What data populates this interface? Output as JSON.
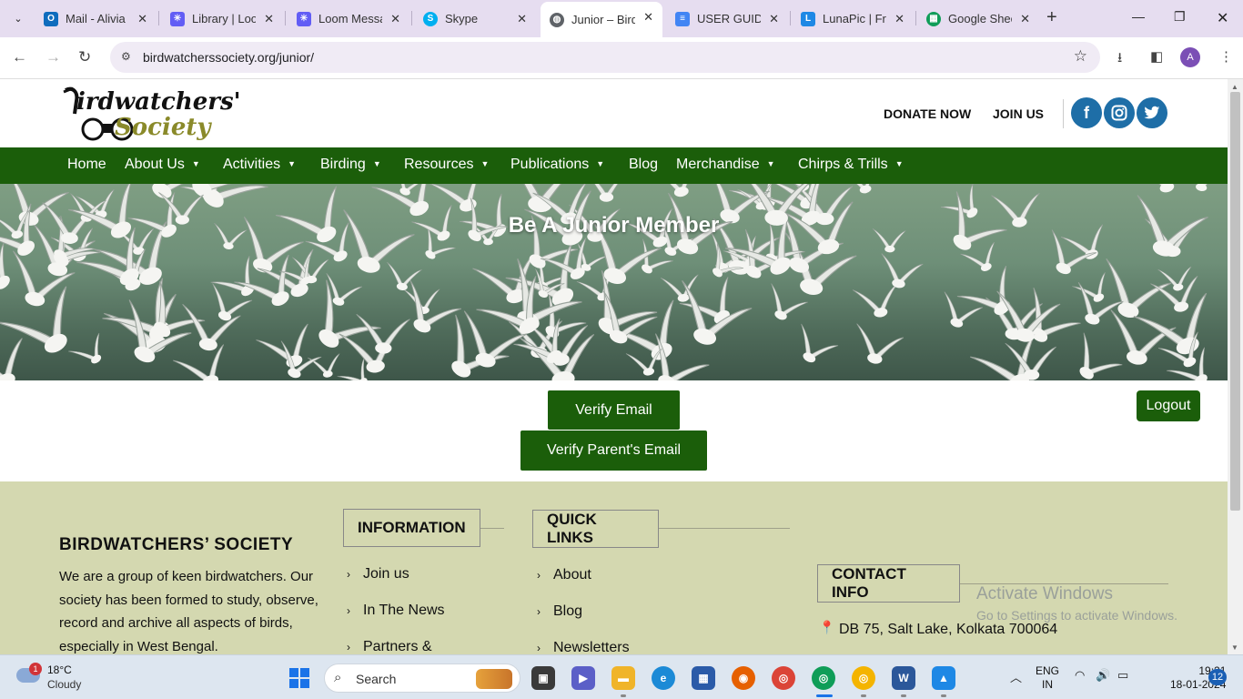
{
  "browser": {
    "tabs": [
      {
        "title": "Mail - Alivia",
        "icon": "outlook-icon",
        "color": "#0f6cbd"
      },
      {
        "title": "Library | Loo",
        "icon": "loom-icon",
        "color": "#625df5"
      },
      {
        "title": "Loom Messa",
        "icon": "loom-icon",
        "color": "#625df5"
      },
      {
        "title": "Skype",
        "icon": "skype-icon",
        "color": "#00aff0"
      },
      {
        "title": "Junior – Bird",
        "icon": "globe-icon",
        "color": "#5f6368"
      },
      {
        "title": "USER GUIDE",
        "icon": "docs-icon",
        "color": "#4285f4"
      },
      {
        "title": "LunaPic | Fre",
        "icon": "lunapic-icon",
        "color": "#1e88e5"
      },
      {
        "title": "Google Shee",
        "icon": "sheets-icon",
        "color": "#0f9d58"
      }
    ],
    "active_tab_index": 4,
    "url": "birdwatcherssociety.org/junior/",
    "profile_initial": "A"
  },
  "site": {
    "logo_line1": "irdwatchers'",
    "logo_line2": "Society",
    "logo_letter": "B",
    "donate_label": "DONATE NOW",
    "join_label": "JOIN US",
    "social": [
      {
        "label": "f",
        "icon": "facebook-icon"
      },
      {
        "label": "◎",
        "icon": "instagram-icon"
      },
      {
        "label": "t",
        "icon": "twitter-icon"
      }
    ],
    "nav": [
      {
        "label": "Home",
        "dropdown": false
      },
      {
        "label": "About Us",
        "dropdown": true
      },
      {
        "label": "Activities",
        "dropdown": true
      },
      {
        "label": "Birding",
        "dropdown": true
      },
      {
        "label": "Resources",
        "dropdown": true
      },
      {
        "label": "Publications",
        "dropdown": true
      },
      {
        "label": "Blog",
        "dropdown": false
      },
      {
        "label": "Merchandise",
        "dropdown": true
      },
      {
        "label": "Chirps & Trills",
        "dropdown": true
      }
    ],
    "hero_title": "Be A Junior Member",
    "verify_email_label": "Verify Email",
    "verify_parent_label": "Verify Parent's Email",
    "logout_label": "Logout",
    "colors": {
      "brand_green": "#1b5e0a",
      "footer_bg": "#d4d8b0"
    }
  },
  "footer": {
    "title": "BIRDWATCHERS’ SOCIETY",
    "description": "We are a group of keen birdwatchers. Our society has been formed to study, observe, record and archive all aspects of birds, especially in West Bengal.",
    "information_heading": "INFORMATION",
    "information_links": [
      "Join us",
      "In The News",
      "Partners &"
    ],
    "quicklinks_heading": "QUICK LINKS",
    "quick_links": [
      "About",
      "Blog",
      "Newsletters"
    ],
    "contact_heading": "CONTACT INFO",
    "address": "DB 75, Salt Lake, Kolkata 700064"
  },
  "watermark": {
    "line1": "Activate Windows",
    "line2": "Go to Settings to activate Windows."
  },
  "taskbar": {
    "weather_temp": "18°C",
    "weather_cond": "Cloudy",
    "weather_badge": "1",
    "search_label": "Search",
    "lang_line1": "ENG",
    "lang_line2": "IN",
    "time": "19:21",
    "date": "18-01-2024",
    "notifications": "12"
  }
}
